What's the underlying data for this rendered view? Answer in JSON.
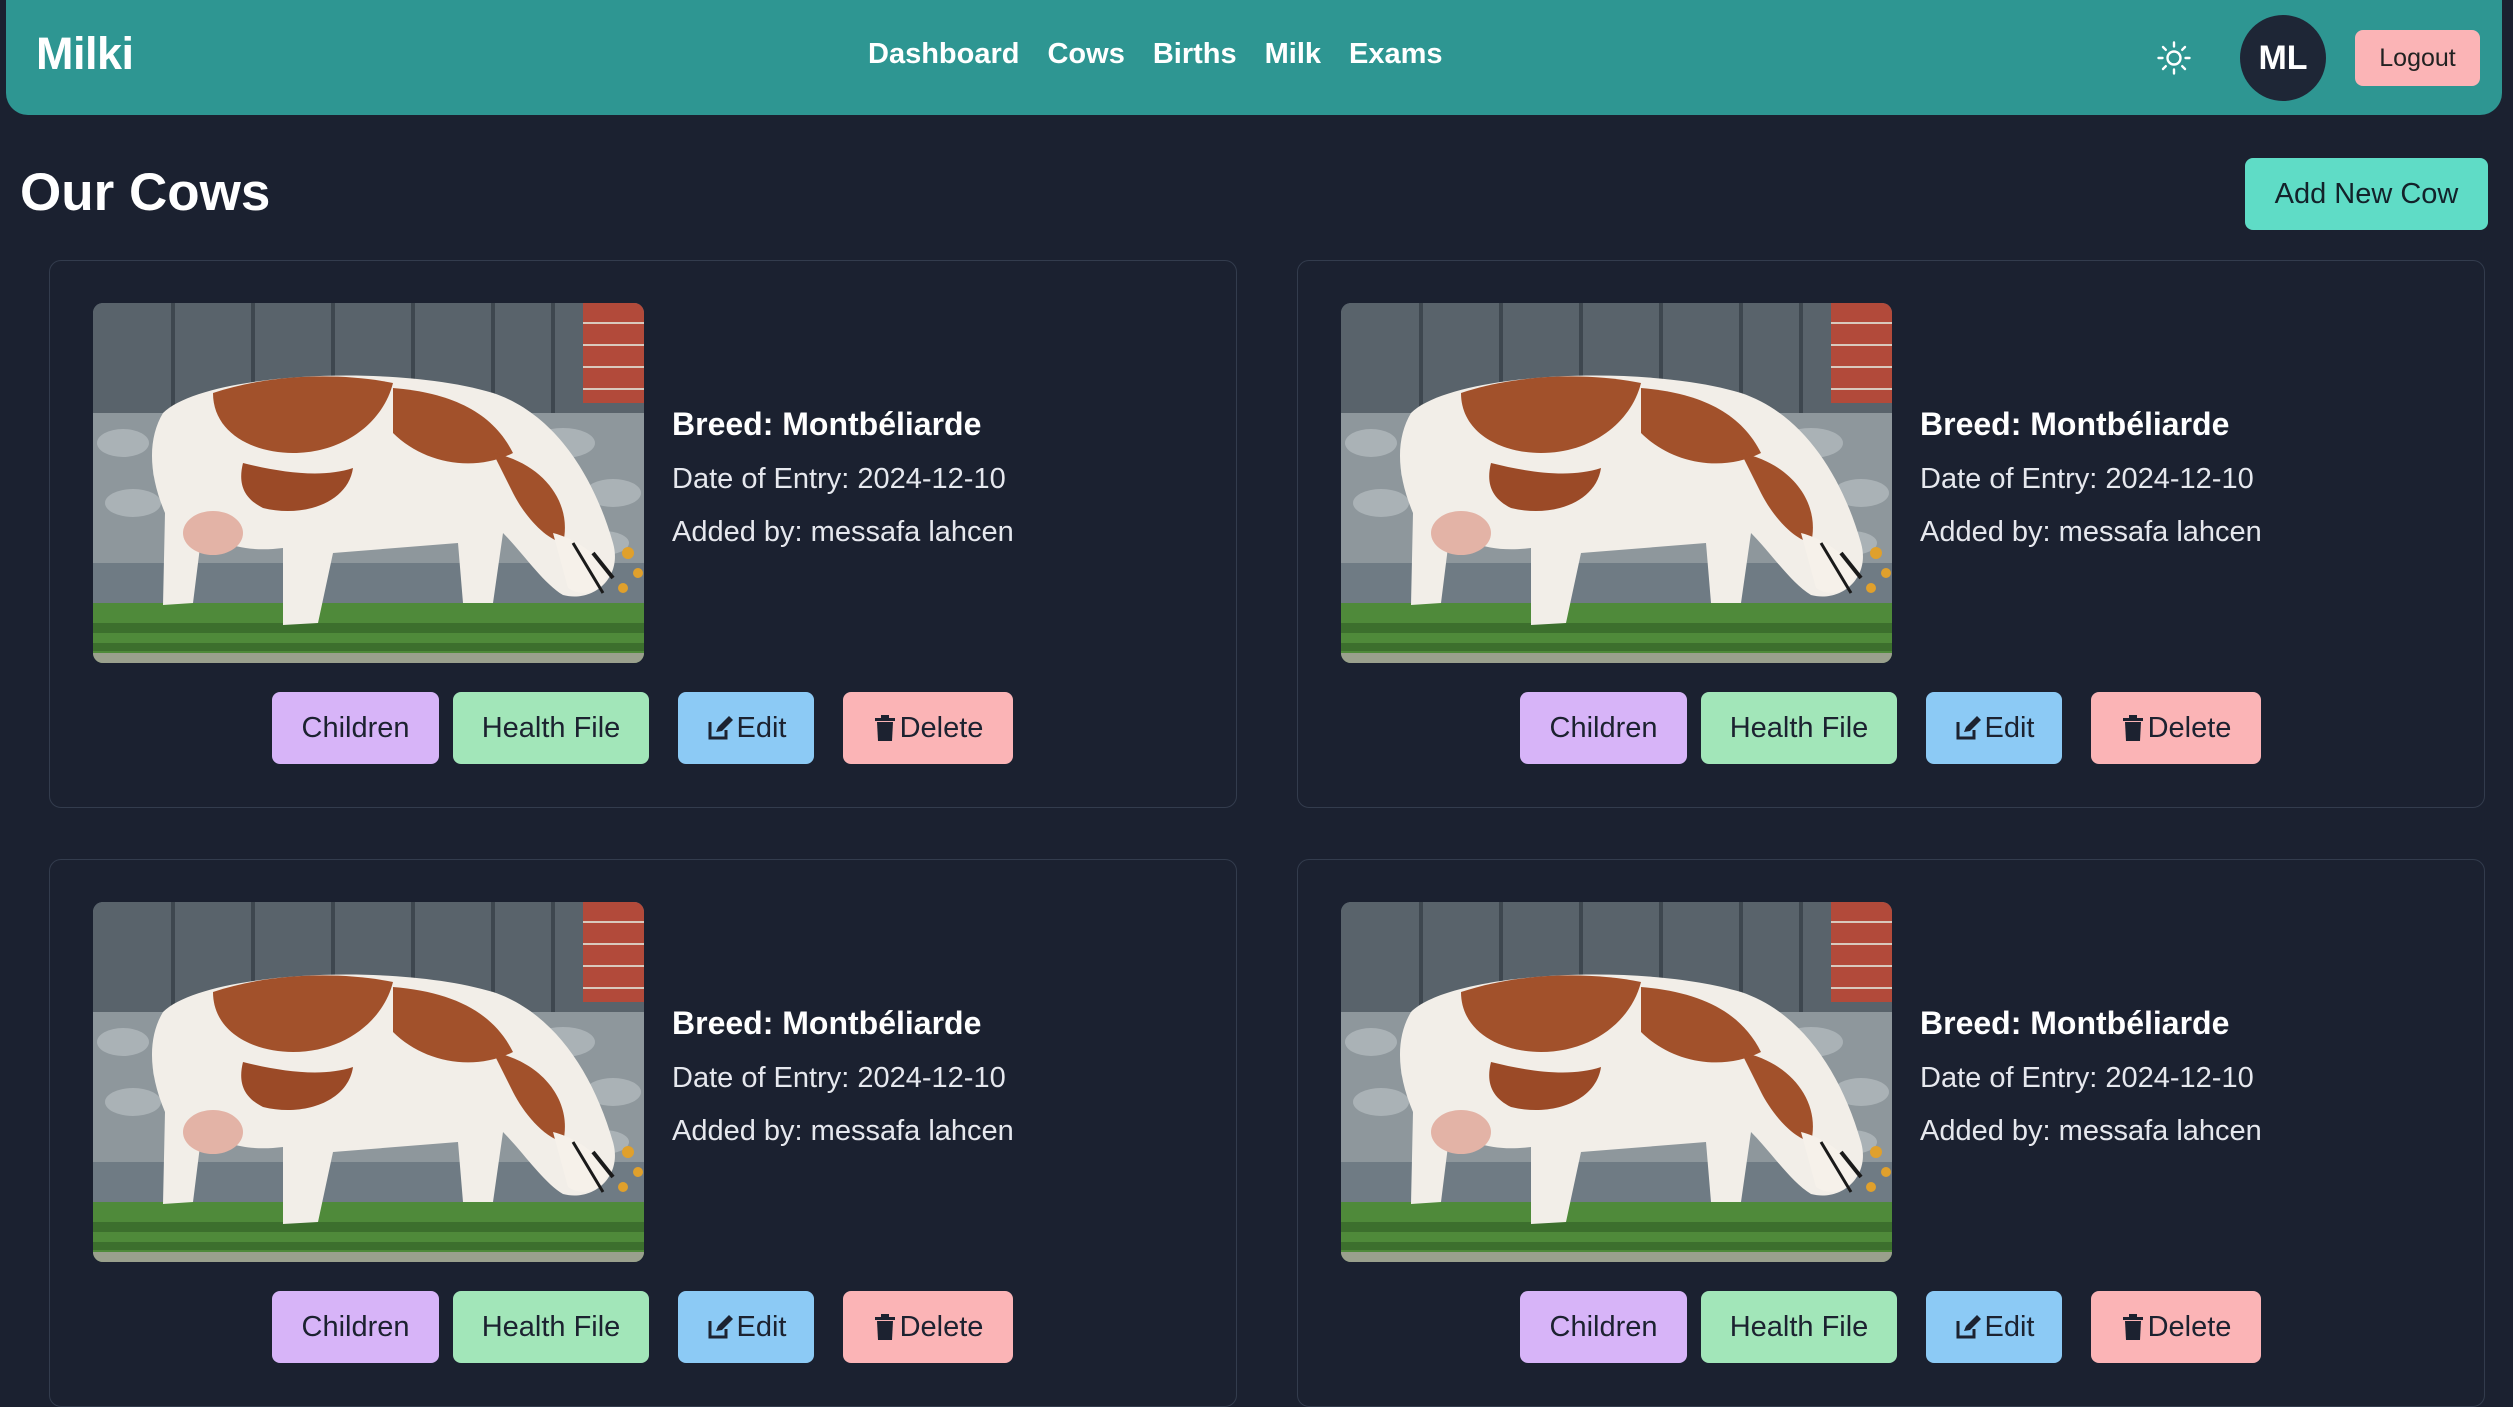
{
  "app": {
    "brand": "Milki"
  },
  "nav": {
    "links": [
      "Dashboard",
      "Cows",
      "Births",
      "Milk",
      "Exams"
    ],
    "avatar_initials": "ML",
    "logout_label": "Logout",
    "theme_icon": "sun-icon"
  },
  "page": {
    "title": "Our Cows",
    "add_button": "Add New Cow"
  },
  "cows": [
    {
      "breed": "Breed: Montbéliarde",
      "entry": "Date of Entry: 2024-12-10",
      "added_by": "Added by: messafa lahcen"
    },
    {
      "breed": "Breed: Montbéliarde",
      "entry": "Date of Entry: 2024-12-10",
      "added_by": "Added by: messafa lahcen"
    },
    {
      "breed": "Breed: Montbéliarde",
      "entry": "Date of Entry: 2024-12-10",
      "added_by": "Added by: messafa lahcen"
    },
    {
      "breed": "Breed: Montbéliarde",
      "entry": "Date of Entry: 2024-12-10",
      "added_by": "Added by: messafa lahcen"
    }
  ],
  "card_actions": {
    "children": "Children",
    "health_file": "Health File",
    "edit": "Edit",
    "delete": "Delete",
    "edit_icon": "edit-icon",
    "delete_icon": "trash-icon"
  },
  "colors": {
    "navbar": "#2e9692",
    "background": "#1b2130",
    "children_button": "#d7b4f8",
    "health_button": "#a2e6b9",
    "edit_button": "#8ccaf5",
    "delete_button": "#fbb4b6",
    "add_button": "#5fdcc6"
  }
}
